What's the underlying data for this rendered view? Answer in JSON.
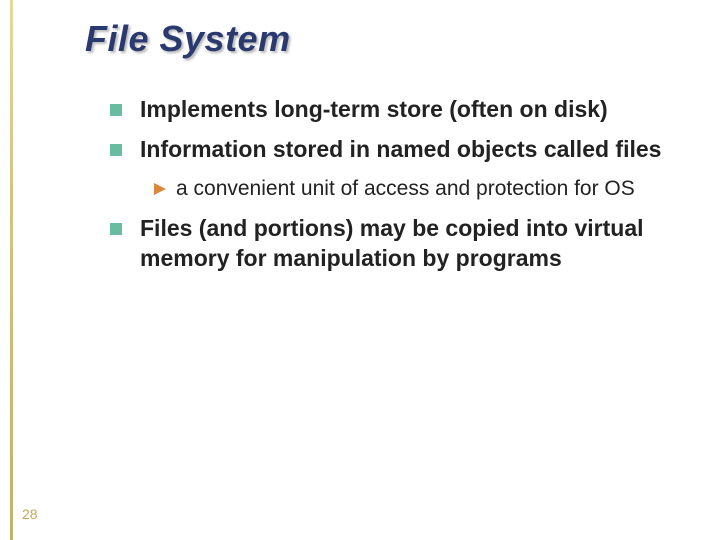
{
  "slide": {
    "title": "File System",
    "page_number": "28",
    "bullets": [
      {
        "level": 1,
        "text": "Implements long-term store (often on disk)"
      },
      {
        "level": 1,
        "text": "Information stored in named objects called files"
      },
      {
        "level": 2,
        "text": "a convenient unit of access and protection for OS"
      },
      {
        "level": 1,
        "text": "Files (and portions) may be copied into virtual memory for manipulation by programs"
      }
    ]
  }
}
